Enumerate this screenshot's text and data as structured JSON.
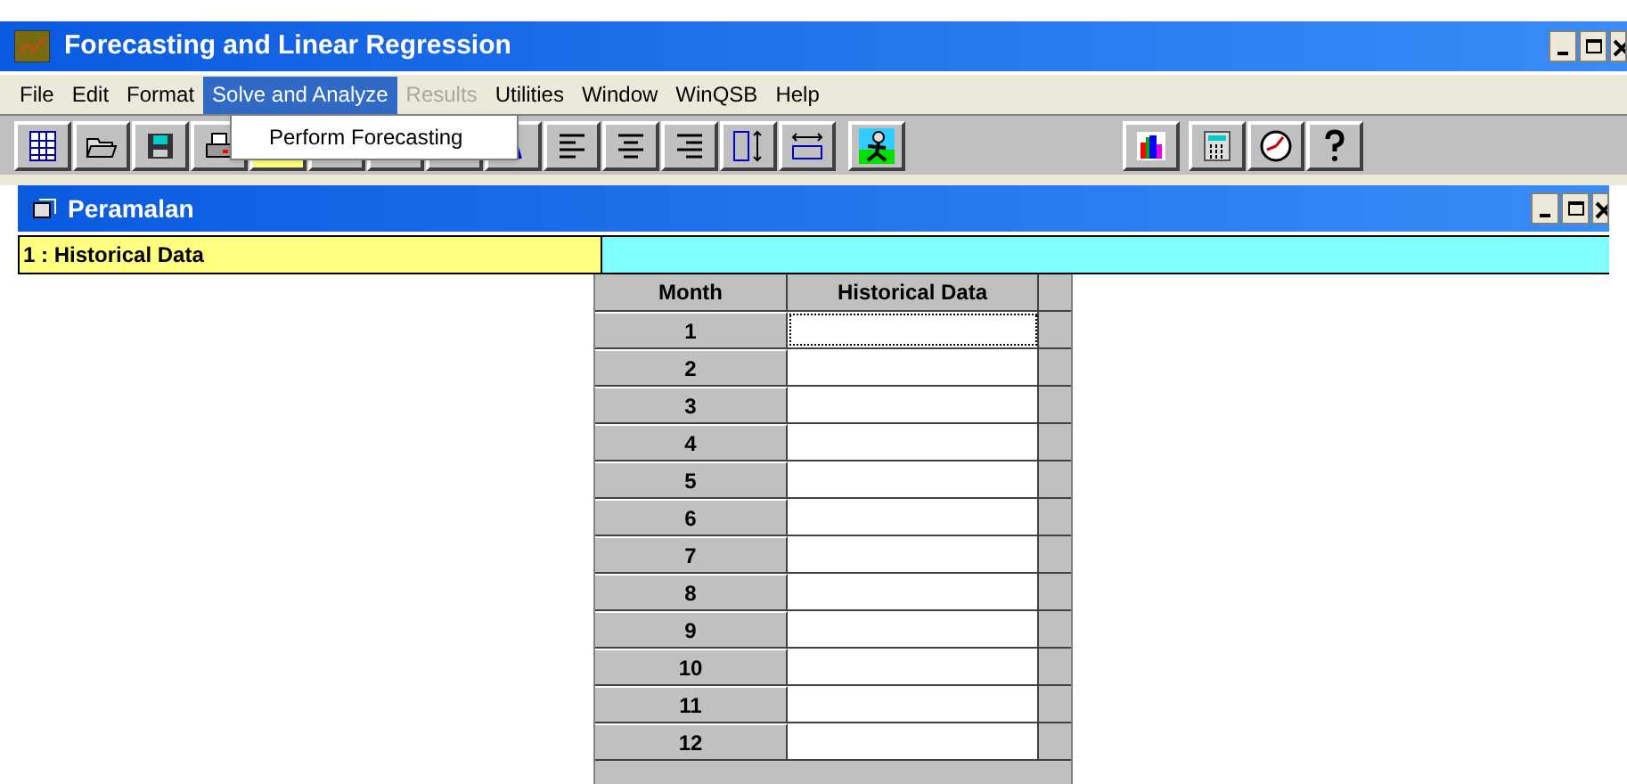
{
  "window": {
    "title": "Forecasting and Linear Regression"
  },
  "menu": [
    {
      "label": "File",
      "selected": false,
      "disabled": false
    },
    {
      "label": "Edit",
      "selected": false,
      "disabled": false
    },
    {
      "label": "Format",
      "selected": false,
      "disabled": false
    },
    {
      "label": "Solve and Analyze",
      "selected": true,
      "disabled": false
    },
    {
      "label": "Results",
      "selected": false,
      "disabled": true
    },
    {
      "label": "Utilities",
      "selected": false,
      "disabled": false
    },
    {
      "label": "Window",
      "selected": false,
      "disabled": false
    },
    {
      "label": "WinQSB",
      "selected": false,
      "disabled": false
    },
    {
      "label": "Help",
      "selected": false,
      "disabled": false
    }
  ],
  "dropdown": {
    "items": [
      "Perform Forecasting"
    ]
  },
  "child_window": {
    "title": "Peramalan"
  },
  "sheet_tab": {
    "label": "1 : Historical Data"
  },
  "table": {
    "columns": [
      "Month",
      "Historical Data"
    ],
    "rows": [
      {
        "label": "1",
        "selected": true
      },
      {
        "label": "2",
        "selected": false
      },
      {
        "label": "3",
        "selected": false
      },
      {
        "label": "4",
        "selected": false
      },
      {
        "label": "5",
        "selected": false
      },
      {
        "label": "6",
        "selected": false
      },
      {
        "label": "7",
        "selected": false
      },
      {
        "label": "8",
        "selected": false
      },
      {
        "label": "9",
        "selected": false
      },
      {
        "label": "10",
        "selected": false
      },
      {
        "label": "11",
        "selected": false
      },
      {
        "label": "12",
        "selected": false
      }
    ]
  }
}
